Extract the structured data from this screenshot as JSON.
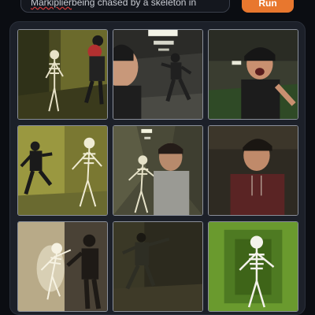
{
  "prompt": {
    "text_prefix": "Markiplier",
    "text_rest": " being chased by a skeleton in"
  },
  "run_button": {
    "label": "Run"
  },
  "results": {
    "images": [
      {
        "subject": "man-fleeing-skeleton-yellow-hallway"
      },
      {
        "subject": "man-running-dark-office"
      },
      {
        "subject": "man-screaming-green-room"
      },
      {
        "subject": "man-fleeing-skeleton-yellow-room"
      },
      {
        "subject": "man-with-skeleton-corridor"
      },
      {
        "subject": "man-portrait-dark-room"
      },
      {
        "subject": "skeleton-lunging-bright-corridor"
      },
      {
        "subject": "man-running-dark-room"
      },
      {
        "subject": "skeleton-green-room"
      }
    ]
  }
}
